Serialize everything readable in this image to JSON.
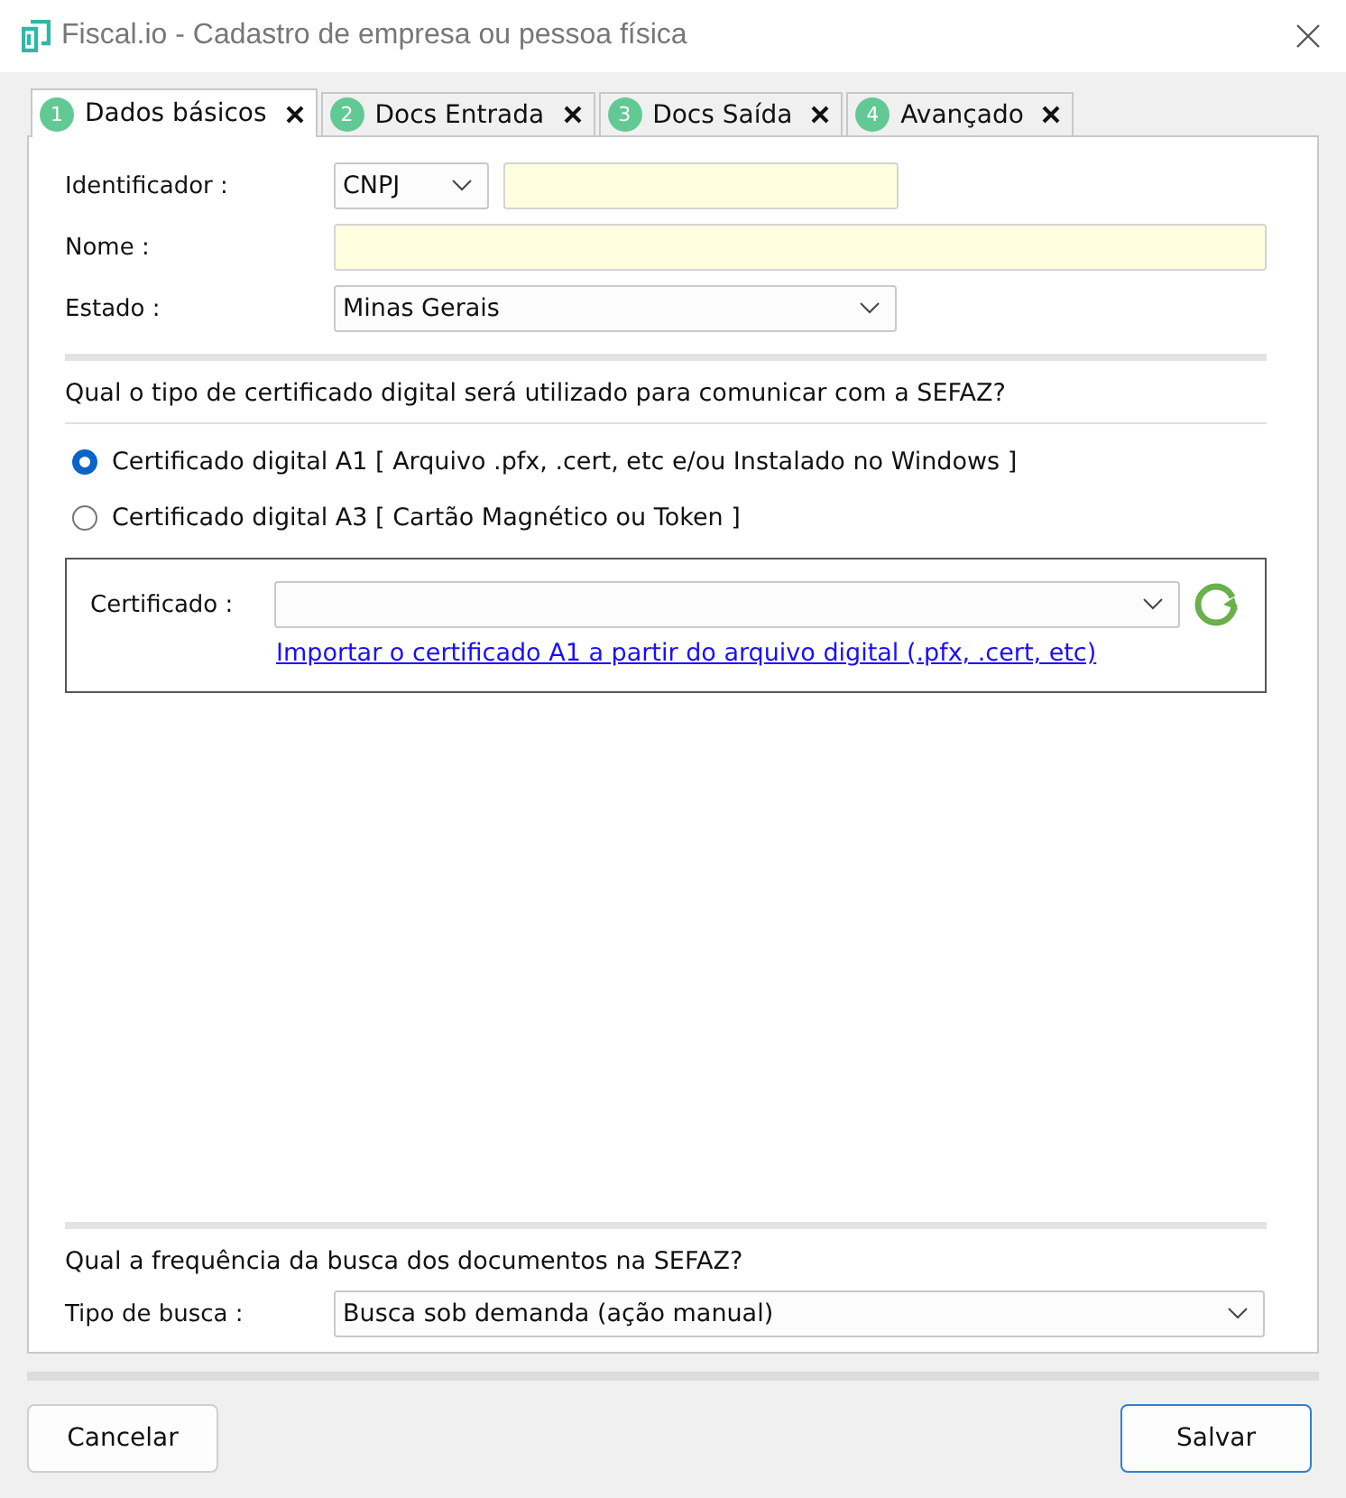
{
  "window": {
    "title": "Fiscal.io - Cadastro de empresa ou pessoa física"
  },
  "tabs": [
    {
      "number": "1",
      "label": "Dados básicos",
      "selected": true
    },
    {
      "number": "2",
      "label": "Docs Entrada",
      "selected": false
    },
    {
      "number": "3",
      "label": "Docs Saída",
      "selected": false
    },
    {
      "number": "4",
      "label": "Avançado",
      "selected": false
    }
  ],
  "identificador": {
    "label": "Identificador :",
    "type": "CNPJ",
    "required": true
  },
  "nome": {
    "label": "Nome :",
    "required": true
  },
  "estado": {
    "label": "Estado :",
    "value": "Minas Gerais"
  },
  "certificate_question": "Qual o tipo de certificado digital será utilizado para comunicar com a SEFAZ?",
  "certificate_options": [
    {
      "label": "Certificado digital A1 [ Arquivo .pfx, .cert, etc e/ou Instalado no Windows ]",
      "selected": true
    },
    {
      "label": "Certificado digital A3 [ Cartão Magnético ou Token ]",
      "selected": false
    }
  ],
  "certificate": {
    "label": "Certificado :",
    "link": "Importar o certificado A1 a partir do arquivo digital (.pfx, .cert, etc)"
  },
  "search_question": "Qual a frequência da busca dos documentos na SEFAZ?",
  "search_type": {
    "label": "Tipo de busca :",
    "value": "Busca sob demanda (ação manual)"
  },
  "buttons": [
    {
      "label": "Cancelar",
      "kind": "cancel"
    },
    {
      "label": "Salvar",
      "kind": "primary"
    }
  ]
}
